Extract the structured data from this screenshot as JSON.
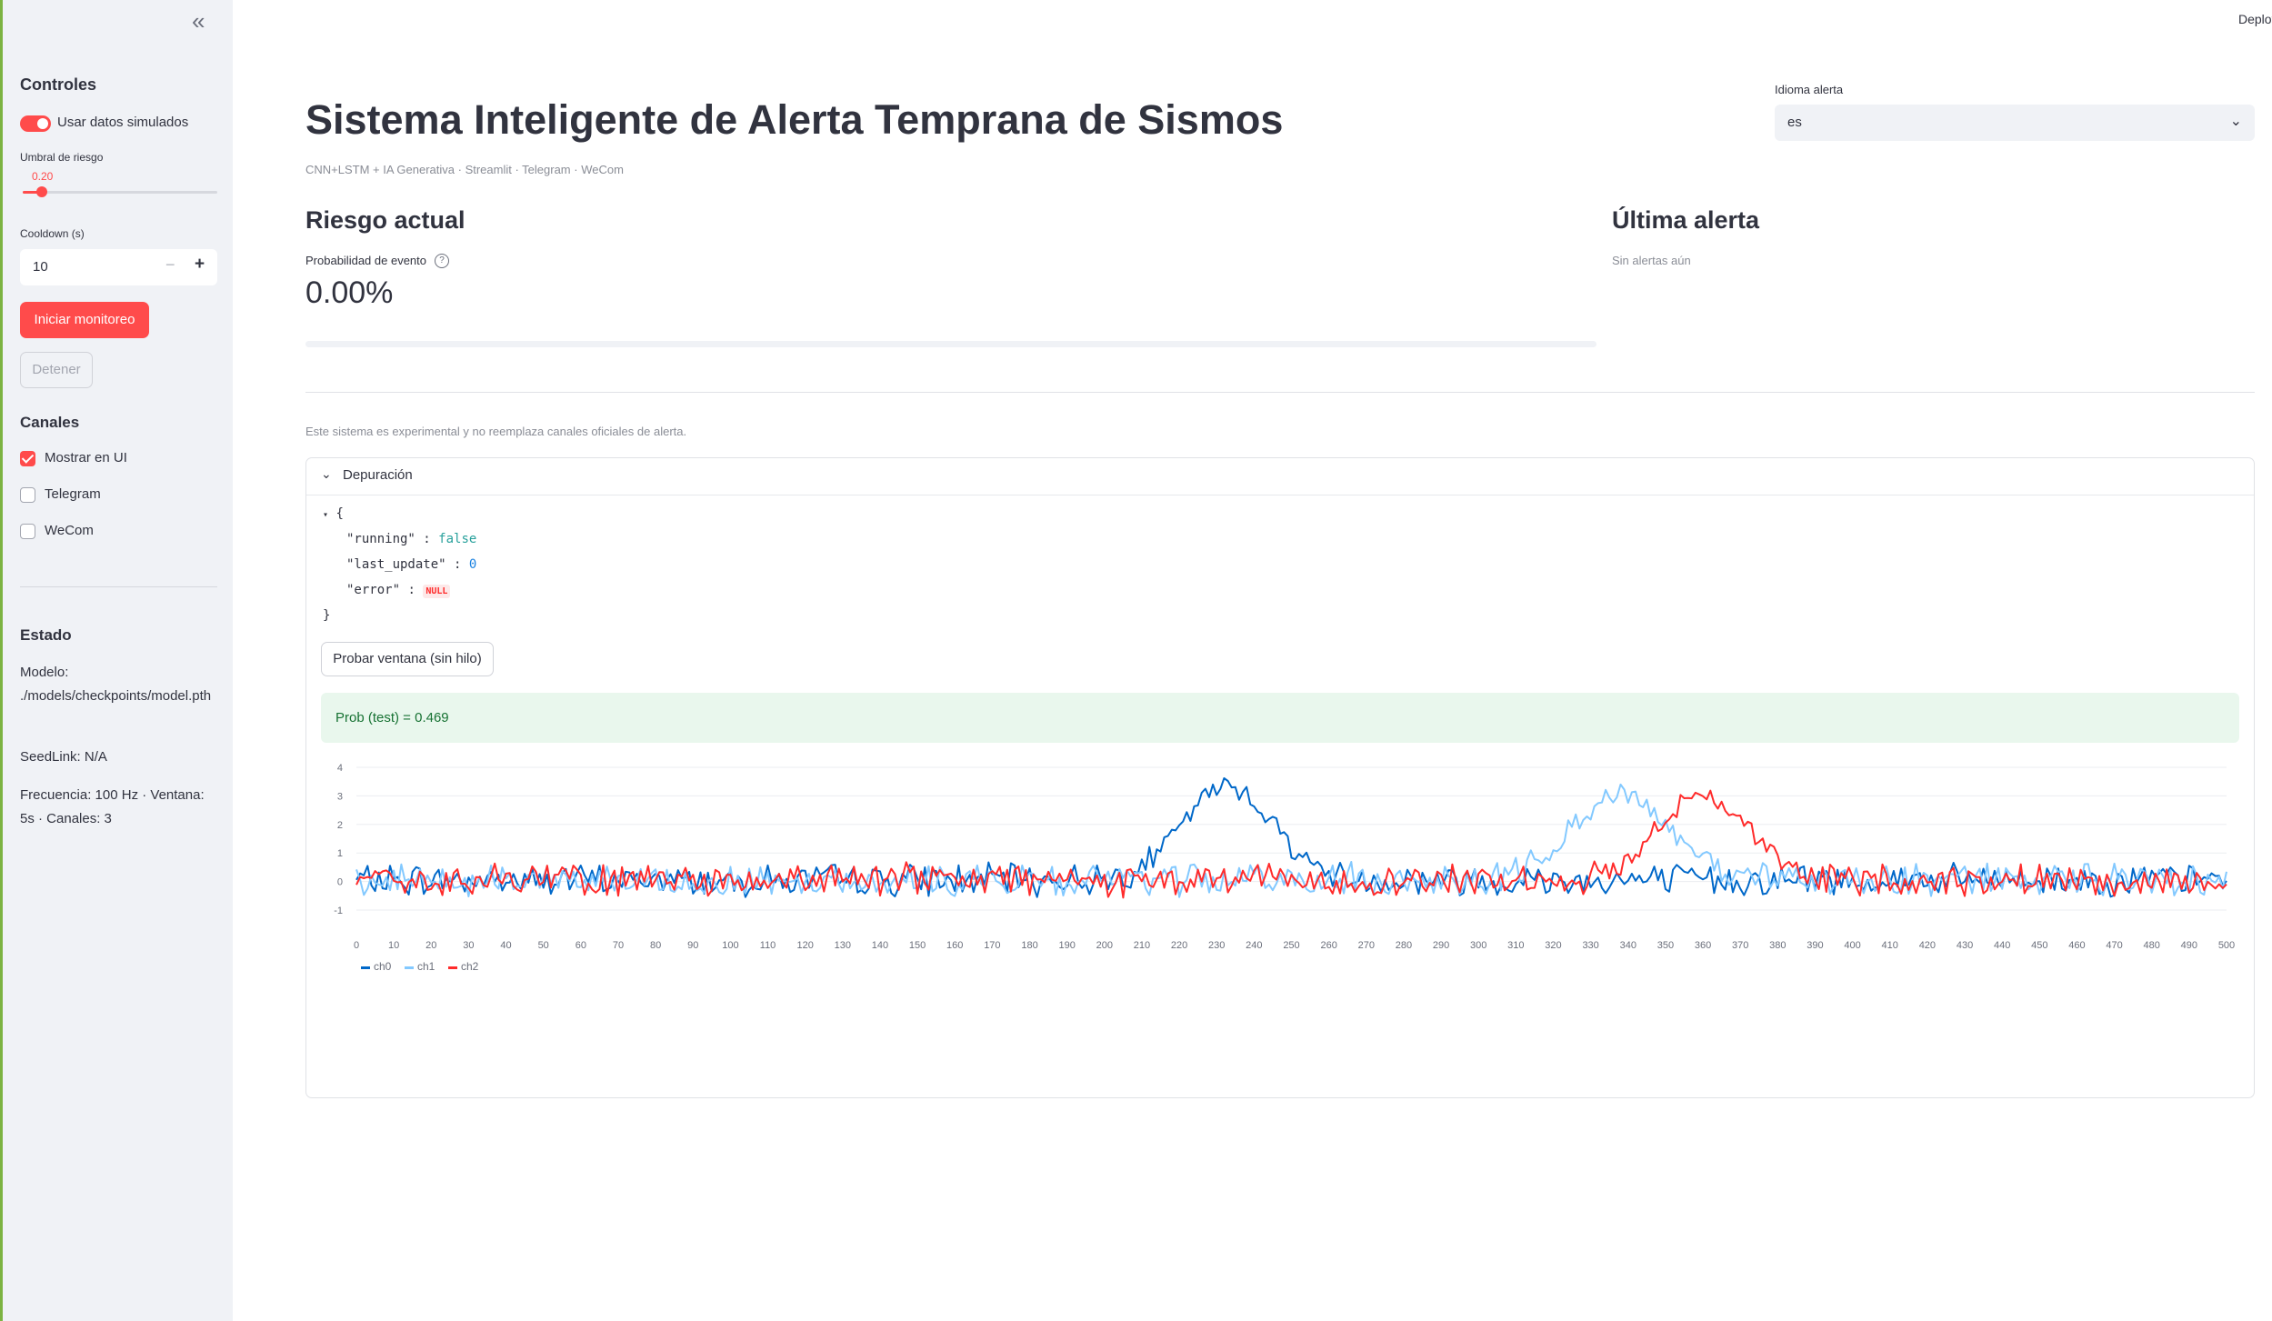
{
  "sidebar": {
    "collapse_icon": "«",
    "controls_title": "Controles",
    "simulated_toggle_label": "Usar datos simulados",
    "simulated_toggle_on": true,
    "risk_threshold_label": "Umbral de riesgo",
    "risk_threshold_value": "0.20",
    "risk_threshold_fraction": 0.1,
    "cooldown_label": "Cooldown (s)",
    "cooldown_value": "10",
    "start_button": "Iniciar monitoreo",
    "stop_button": "Detener",
    "channels_title": "Canales",
    "channels": [
      {
        "label": "Mostrar en UI",
        "checked": true
      },
      {
        "label": "Telegram",
        "checked": false
      },
      {
        "label": "WeCom",
        "checked": false
      }
    ],
    "status_title": "Estado",
    "model_text": "Modelo: ./models/checkpoints/model.pth",
    "seedlink_text": "SeedLink: N/A",
    "freq_text": "Frecuencia: 100 Hz · Ventana: 5s · Canales: 3"
  },
  "header": {
    "deploy_label": "Deploy"
  },
  "main": {
    "title": "Sistema Inteligente de Alerta Temprana de Sismos",
    "caption": "CNN+LSTM + IA Generativa · Streamlit · Telegram · WeCom",
    "language_label": "Idioma alerta",
    "language_value": "es",
    "risk_title": "Riesgo actual",
    "metric_label": "Probabilidad de evento",
    "metric_value": "0.00%",
    "progress_fraction": 0.0,
    "last_alert_title": "Última alerta",
    "no_alerts_text": "Sin alertas aún",
    "disclaimer": "Este sistema es experimental y no reemplaza canales oficiales de alerta.",
    "debug_title": "Depuración",
    "json_open": "{",
    "json_close": "}",
    "json_entries": [
      {
        "key": "\"running\"",
        "value": "false",
        "type": "bool"
      },
      {
        "key": "\"last_update\"",
        "value": "0",
        "type": "num"
      },
      {
        "key": "\"error\"",
        "value": "NULL",
        "type": "null"
      }
    ],
    "test_button": "Probar ventana (sin hilo)",
    "test_result": "Prob (test) = 0.469"
  },
  "chart_data": {
    "type": "line",
    "xlim": [
      0,
      500
    ],
    "ylim": [
      -1,
      4
    ],
    "x_ticks": [
      0,
      10,
      20,
      30,
      40,
      50,
      60,
      70,
      80,
      90,
      100,
      110,
      120,
      130,
      140,
      150,
      160,
      170,
      180,
      190,
      200,
      210,
      220,
      230,
      240,
      250,
      260,
      270,
      280,
      290,
      300,
      310,
      320,
      330,
      340,
      350,
      360,
      370,
      380,
      390,
      400,
      410,
      420,
      430,
      440,
      450,
      460,
      470,
      480,
      490,
      500
    ],
    "y_ticks": [
      -1,
      0,
      1,
      2,
      3,
      4
    ],
    "legend_position": "bottom-left",
    "series": [
      {
        "name": "ch0",
        "color": "#0068c9",
        "peak_center": 233,
        "peak_width": 12,
        "peak_amplitude": 3.3,
        "values_sampled": {
          "x": [
            0,
            50,
            100,
            150,
            200,
            210,
            220,
            225,
            230,
            233,
            236,
            240,
            245,
            250,
            260,
            300,
            350,
            400,
            450,
            500
          ],
          "y": [
            0.1,
            0.1,
            0.0,
            0.1,
            0.0,
            0.2,
            0.9,
            1.9,
            2.9,
            3.7,
            2.9,
            2.6,
            1.4,
            0.6,
            0.1,
            0.0,
            0.1,
            0.0,
            0.1,
            0.1
          ]
        }
      },
      {
        "name": "ch1",
        "color": "#83c9ff",
        "peak_center": 338,
        "peak_width": 13,
        "peak_amplitude": 3.0,
        "values_sampled": {
          "x": [
            0,
            50,
            100,
            150,
            200,
            250,
            300,
            320,
            325,
            330,
            335,
            338,
            342,
            345,
            350,
            355,
            360,
            370,
            400,
            450,
            500
          ],
          "y": [
            0.1,
            0.0,
            0.1,
            0.0,
            -0.1,
            0.0,
            0.0,
            0.2,
            0.6,
            1.9,
            2.8,
            3.2,
            3.0,
            2.8,
            1.6,
            1.4,
            0.8,
            0.0,
            0.0,
            0.1,
            0.1
          ]
        }
      },
      {
        "name": "ch2",
        "color": "#ff2b2b",
        "peak_center": 360,
        "peak_width": 12,
        "peak_amplitude": 3.0,
        "values_sampled": {
          "x": [
            0,
            50,
            100,
            150,
            200,
            250,
            300,
            340,
            345,
            350,
            355,
            358,
            362,
            365,
            370,
            375,
            380,
            400,
            450,
            500
          ],
          "y": [
            0.1,
            0.0,
            0.1,
            0.0,
            0.1,
            0.0,
            0.1,
            0.0,
            0.9,
            1.4,
            2.6,
            3.3,
            3.2,
            2.9,
            2.3,
            1.3,
            0.2,
            0.0,
            0.1,
            0.0
          ]
        }
      }
    ]
  }
}
